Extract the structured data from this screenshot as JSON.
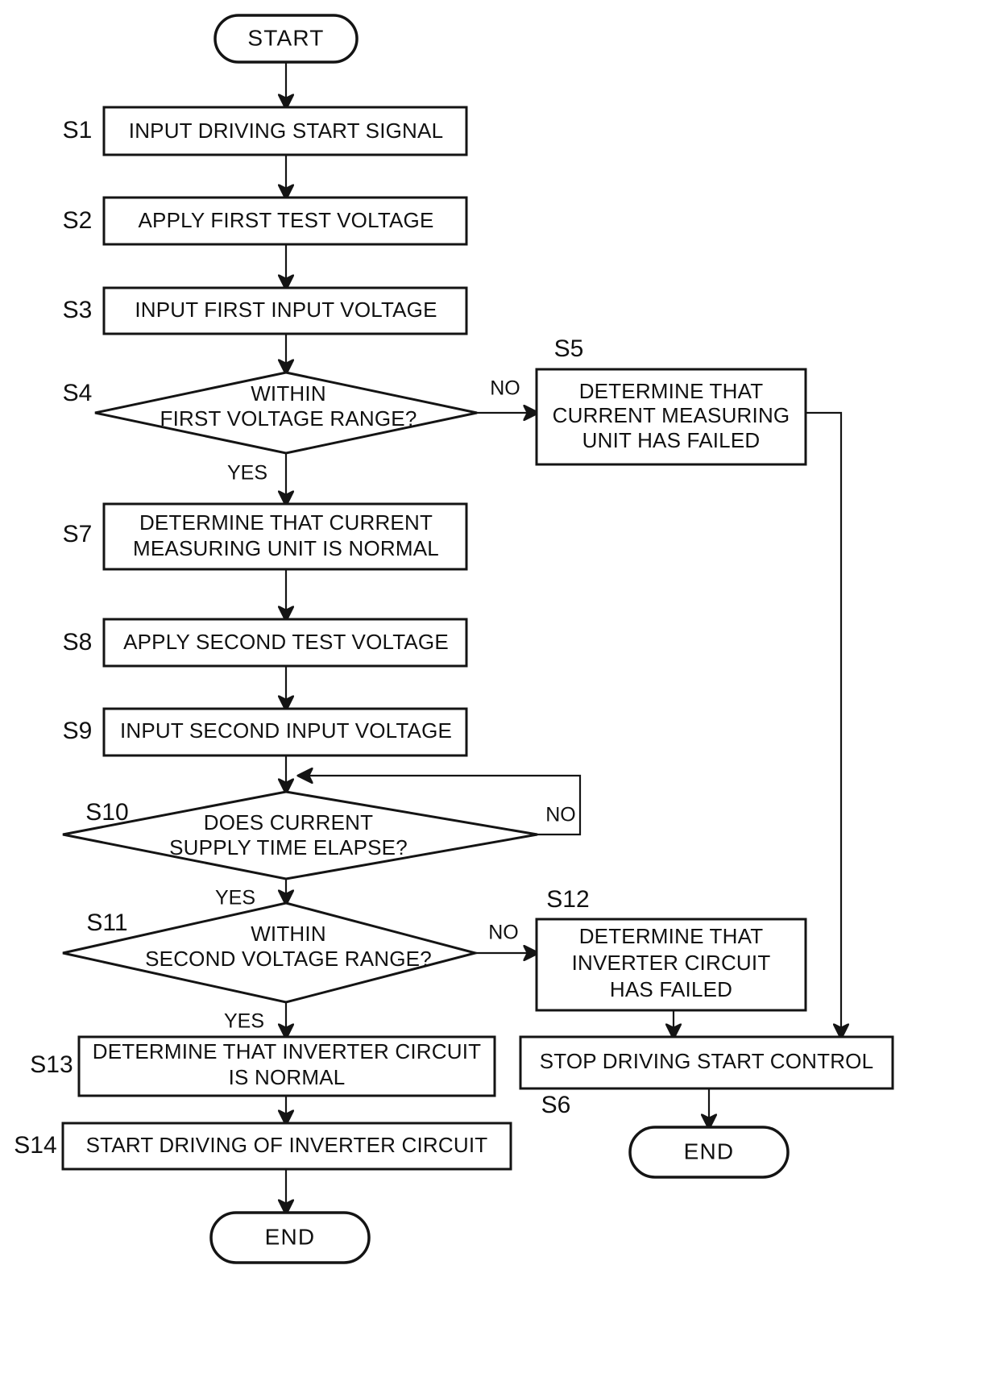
{
  "diagram": {
    "type": "flowchart",
    "title": "",
    "terminators": {
      "start": "START",
      "end_left": "END",
      "end_right": "END"
    },
    "nodes": [
      {
        "id": "start",
        "step": "",
        "shape": "terminator",
        "lines": [
          "START"
        ]
      },
      {
        "id": "s1",
        "step": "S1",
        "shape": "process",
        "lines": [
          "INPUT DRIVING START SIGNAL"
        ]
      },
      {
        "id": "s2",
        "step": "S2",
        "shape": "process",
        "lines": [
          "APPLY FIRST TEST VOLTAGE"
        ]
      },
      {
        "id": "s3",
        "step": "S3",
        "shape": "process",
        "lines": [
          "INPUT FIRST INPUT VOLTAGE"
        ]
      },
      {
        "id": "s4",
        "step": "S4",
        "shape": "decision",
        "lines": [
          "WITHIN",
          "FIRST VOLTAGE RANGE?"
        ]
      },
      {
        "id": "s5",
        "step": "S5",
        "shape": "process",
        "lines": [
          "DETERMINE THAT",
          "CURRENT MEASURING",
          "UNIT HAS FAILED"
        ]
      },
      {
        "id": "s7",
        "step": "S7",
        "shape": "process",
        "lines": [
          "DETERMINE THAT CURRENT",
          "MEASURING UNIT IS NORMAL"
        ]
      },
      {
        "id": "s8",
        "step": "S8",
        "shape": "process",
        "lines": [
          "APPLY SECOND TEST VOLTAGE"
        ]
      },
      {
        "id": "s9",
        "step": "S9",
        "shape": "process",
        "lines": [
          "INPUT SECOND INPUT VOLTAGE"
        ]
      },
      {
        "id": "s10",
        "step": "S10",
        "shape": "decision",
        "lines": [
          "DOES CURRENT",
          "SUPPLY TIME ELAPSE?"
        ]
      },
      {
        "id": "s11",
        "step": "S11",
        "shape": "decision",
        "lines": [
          "WITHIN",
          "SECOND VOLTAGE RANGE?"
        ]
      },
      {
        "id": "s12",
        "step": "S12",
        "shape": "process",
        "lines": [
          "DETERMINE THAT",
          "INVERTER CIRCUIT",
          "HAS FAILED"
        ]
      },
      {
        "id": "s13",
        "step": "S13",
        "shape": "process",
        "lines": [
          "DETERMINE THAT INVERTER CIRCUIT",
          "IS NORMAL"
        ]
      },
      {
        "id": "s14",
        "step": "S14",
        "shape": "process",
        "lines": [
          "START DRIVING OF INVERTER CIRCUIT"
        ]
      },
      {
        "id": "s6",
        "step": "S6",
        "shape": "process",
        "lines": [
          "STOP DRIVING START CONTROL"
        ]
      },
      {
        "id": "end_left",
        "step": "",
        "shape": "terminator",
        "lines": [
          "END"
        ]
      },
      {
        "id": "end_right",
        "step": "",
        "shape": "terminator",
        "lines": [
          "END"
        ]
      }
    ],
    "edges": [
      {
        "from": "start",
        "to": "s1",
        "label": ""
      },
      {
        "from": "s1",
        "to": "s2",
        "label": ""
      },
      {
        "from": "s2",
        "to": "s3",
        "label": ""
      },
      {
        "from": "s3",
        "to": "s4",
        "label": ""
      },
      {
        "from": "s4",
        "to": "s5",
        "label": "NO"
      },
      {
        "from": "s4",
        "to": "s7",
        "label": "YES"
      },
      {
        "from": "s5",
        "to": "s6",
        "label": ""
      },
      {
        "from": "s7",
        "to": "s8",
        "label": ""
      },
      {
        "from": "s8",
        "to": "s9",
        "label": ""
      },
      {
        "from": "s9",
        "to": "s10",
        "label": ""
      },
      {
        "from": "s10",
        "to": "s10",
        "label": "NO"
      },
      {
        "from": "s10",
        "to": "s11",
        "label": "YES"
      },
      {
        "from": "s11",
        "to": "s12",
        "label": "NO"
      },
      {
        "from": "s11",
        "to": "s13",
        "label": "YES"
      },
      {
        "from": "s12",
        "to": "s6",
        "label": ""
      },
      {
        "from": "s13",
        "to": "s14",
        "label": ""
      },
      {
        "from": "s14",
        "to": "end_left",
        "label": ""
      },
      {
        "from": "s6",
        "to": "end_right",
        "label": ""
      }
    ],
    "edge_labels": {
      "s4_no": "NO",
      "s4_yes": "YES",
      "s10_no": "NO",
      "s10_yes": "YES",
      "s11_no": "NO",
      "s11_yes": "YES"
    },
    "step_labels": {
      "s1": "S1",
      "s2": "S2",
      "s3": "S3",
      "s4": "S4",
      "s5": "S5",
      "s6": "S6",
      "s7": "S7",
      "s8": "S8",
      "s9": "S9",
      "s10": "S10",
      "s11": "S11",
      "s12": "S12",
      "s13": "S13",
      "s14": "S14"
    },
    "colors": {
      "stroke": "#141414",
      "fill": "#ffffff",
      "text": "#111111"
    }
  }
}
